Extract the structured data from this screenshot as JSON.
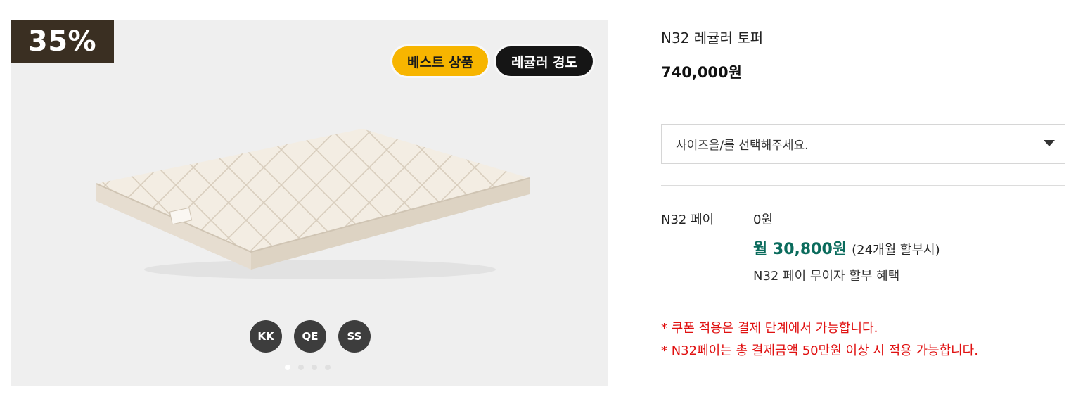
{
  "gallery": {
    "discount": "35%",
    "tags": {
      "best": "베스트 상품",
      "hardness": "레귤러 경도"
    },
    "sizes": [
      "KK",
      "QE",
      "SS"
    ],
    "slide_count": 4,
    "active_slide": 1
  },
  "product": {
    "title": "N32 레귤러 토퍼",
    "price": "740,000원",
    "select_placeholder": "사이즈을/를 선택해주세요."
  },
  "payment": {
    "label": "N32 페이",
    "old_price": "0원",
    "monthly": "월 30,800원",
    "installment_note": "(24개월 할부시)",
    "benefit_link": "N32 페이 무이자 할부 혜택"
  },
  "notices": [
    "* 쿠폰 적용은 결제 단계에서 가능합니다.",
    "* N32페이는 총 결제금액 50만원 이상 시 적용 가능합니다."
  ],
  "colors": {
    "discount_bg": "#3a2f22",
    "best_tag": "#f7b500",
    "hardness_tag": "#151515",
    "monthly_price": "#0a6b5c",
    "notice": "#e01010"
  }
}
